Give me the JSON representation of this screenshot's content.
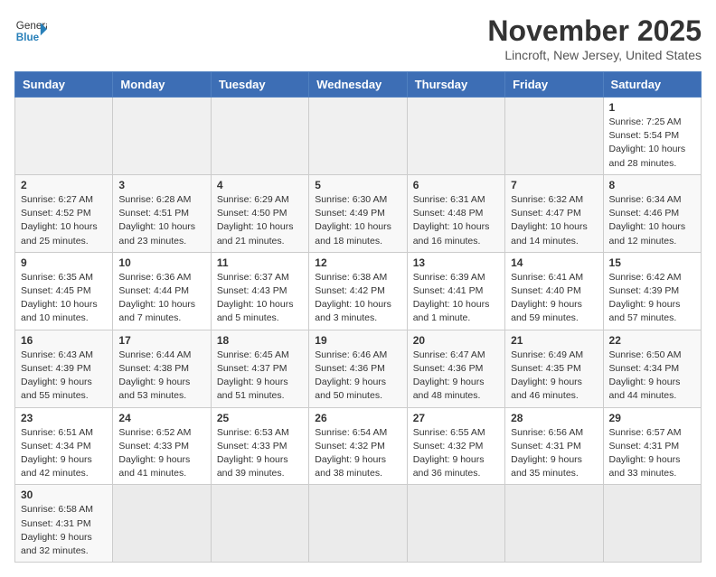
{
  "header": {
    "logo_general": "General",
    "logo_blue": "Blue",
    "month": "November 2025",
    "location": "Lincroft, New Jersey, United States"
  },
  "days_of_week": [
    "Sunday",
    "Monday",
    "Tuesday",
    "Wednesday",
    "Thursday",
    "Friday",
    "Saturday"
  ],
  "weeks": [
    [
      {
        "day": "",
        "info": ""
      },
      {
        "day": "",
        "info": ""
      },
      {
        "day": "",
        "info": ""
      },
      {
        "day": "",
        "info": ""
      },
      {
        "day": "",
        "info": ""
      },
      {
        "day": "",
        "info": ""
      },
      {
        "day": "1",
        "info": "Sunrise: 7:25 AM\nSunset: 5:54 PM\nDaylight: 10 hours and 28 minutes."
      }
    ],
    [
      {
        "day": "2",
        "info": "Sunrise: 6:27 AM\nSunset: 4:52 PM\nDaylight: 10 hours and 25 minutes."
      },
      {
        "day": "3",
        "info": "Sunrise: 6:28 AM\nSunset: 4:51 PM\nDaylight: 10 hours and 23 minutes."
      },
      {
        "day": "4",
        "info": "Sunrise: 6:29 AM\nSunset: 4:50 PM\nDaylight: 10 hours and 21 minutes."
      },
      {
        "day": "5",
        "info": "Sunrise: 6:30 AM\nSunset: 4:49 PM\nDaylight: 10 hours and 18 minutes."
      },
      {
        "day": "6",
        "info": "Sunrise: 6:31 AM\nSunset: 4:48 PM\nDaylight: 10 hours and 16 minutes."
      },
      {
        "day": "7",
        "info": "Sunrise: 6:32 AM\nSunset: 4:47 PM\nDaylight: 10 hours and 14 minutes."
      },
      {
        "day": "8",
        "info": "Sunrise: 6:34 AM\nSunset: 4:46 PM\nDaylight: 10 hours and 12 minutes."
      }
    ],
    [
      {
        "day": "9",
        "info": "Sunrise: 6:35 AM\nSunset: 4:45 PM\nDaylight: 10 hours and 10 minutes."
      },
      {
        "day": "10",
        "info": "Sunrise: 6:36 AM\nSunset: 4:44 PM\nDaylight: 10 hours and 7 minutes."
      },
      {
        "day": "11",
        "info": "Sunrise: 6:37 AM\nSunset: 4:43 PM\nDaylight: 10 hours and 5 minutes."
      },
      {
        "day": "12",
        "info": "Sunrise: 6:38 AM\nSunset: 4:42 PM\nDaylight: 10 hours and 3 minutes."
      },
      {
        "day": "13",
        "info": "Sunrise: 6:39 AM\nSunset: 4:41 PM\nDaylight: 10 hours and 1 minute."
      },
      {
        "day": "14",
        "info": "Sunrise: 6:41 AM\nSunset: 4:40 PM\nDaylight: 9 hours and 59 minutes."
      },
      {
        "day": "15",
        "info": "Sunrise: 6:42 AM\nSunset: 4:39 PM\nDaylight: 9 hours and 57 minutes."
      }
    ],
    [
      {
        "day": "16",
        "info": "Sunrise: 6:43 AM\nSunset: 4:39 PM\nDaylight: 9 hours and 55 minutes."
      },
      {
        "day": "17",
        "info": "Sunrise: 6:44 AM\nSunset: 4:38 PM\nDaylight: 9 hours and 53 minutes."
      },
      {
        "day": "18",
        "info": "Sunrise: 6:45 AM\nSunset: 4:37 PM\nDaylight: 9 hours and 51 minutes."
      },
      {
        "day": "19",
        "info": "Sunrise: 6:46 AM\nSunset: 4:36 PM\nDaylight: 9 hours and 50 minutes."
      },
      {
        "day": "20",
        "info": "Sunrise: 6:47 AM\nSunset: 4:36 PM\nDaylight: 9 hours and 48 minutes."
      },
      {
        "day": "21",
        "info": "Sunrise: 6:49 AM\nSunset: 4:35 PM\nDaylight: 9 hours and 46 minutes."
      },
      {
        "day": "22",
        "info": "Sunrise: 6:50 AM\nSunset: 4:34 PM\nDaylight: 9 hours and 44 minutes."
      }
    ],
    [
      {
        "day": "23",
        "info": "Sunrise: 6:51 AM\nSunset: 4:34 PM\nDaylight: 9 hours and 42 minutes."
      },
      {
        "day": "24",
        "info": "Sunrise: 6:52 AM\nSunset: 4:33 PM\nDaylight: 9 hours and 41 minutes."
      },
      {
        "day": "25",
        "info": "Sunrise: 6:53 AM\nSunset: 4:33 PM\nDaylight: 9 hours and 39 minutes."
      },
      {
        "day": "26",
        "info": "Sunrise: 6:54 AM\nSunset: 4:32 PM\nDaylight: 9 hours and 38 minutes."
      },
      {
        "day": "27",
        "info": "Sunrise: 6:55 AM\nSunset: 4:32 PM\nDaylight: 9 hours and 36 minutes."
      },
      {
        "day": "28",
        "info": "Sunrise: 6:56 AM\nSunset: 4:31 PM\nDaylight: 9 hours and 35 minutes."
      },
      {
        "day": "29",
        "info": "Sunrise: 6:57 AM\nSunset: 4:31 PM\nDaylight: 9 hours and 33 minutes."
      }
    ],
    [
      {
        "day": "30",
        "info": "Sunrise: 6:58 AM\nSunset: 4:31 PM\nDaylight: 9 hours and 32 minutes."
      },
      {
        "day": "",
        "info": ""
      },
      {
        "day": "",
        "info": ""
      },
      {
        "day": "",
        "info": ""
      },
      {
        "day": "",
        "info": ""
      },
      {
        "day": "",
        "info": ""
      },
      {
        "day": "",
        "info": ""
      }
    ]
  ]
}
